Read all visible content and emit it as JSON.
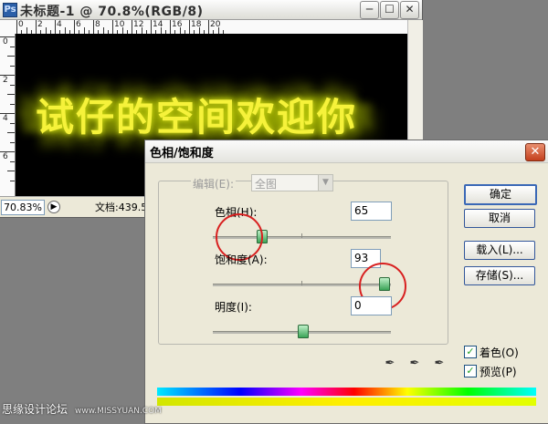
{
  "document_window": {
    "title": "未标题-1 @ 70.8%(RGB/8)",
    "app_icon": "photoshop-icon",
    "ruler_top_labels": [
      "0",
      "2",
      "4",
      "6",
      "8",
      "10",
      "12",
      "14",
      "16",
      "18",
      "20"
    ],
    "ruler_left_labels": [
      "0",
      "2",
      "4",
      "6"
    ],
    "canvas_text": "试仔的空间欢迎你",
    "canvas_text_color": "#f6f23a",
    "zoom": "70.83%",
    "doc_info": "文档:439.5"
  },
  "dialog": {
    "title": "色相/饱和度",
    "edit_label": "编辑(E):",
    "edit_value": "全图",
    "hue": {
      "label": "色相(H):",
      "value": "65",
      "level_fraction": 0.27
    },
    "saturation": {
      "label": "饱和度(A):",
      "value": "93",
      "level_fraction": 0.96
    },
    "lightness": {
      "label": "明度(I):",
      "value": "0",
      "level_fraction": 0.5
    },
    "buttons": {
      "ok": "确定",
      "cancel": "取消",
      "load": "载入(L)...",
      "save": "存储(S)..."
    },
    "colorize": {
      "label": "着色(O)",
      "checked": true
    },
    "preview": {
      "label": "预览(P)",
      "checked": true
    },
    "eyedroppers": [
      "eyedropper-icon",
      "eyedropper-plus-icon",
      "eyedropper-minus-icon"
    ]
  },
  "watermark": {
    "text": "思缘设计论坛",
    "url": "www.MISSYUAN.COM"
  },
  "colors": {
    "thumb": "#3aa457",
    "highlight_circle": "#d82020",
    "background": "#7f7f7f"
  }
}
